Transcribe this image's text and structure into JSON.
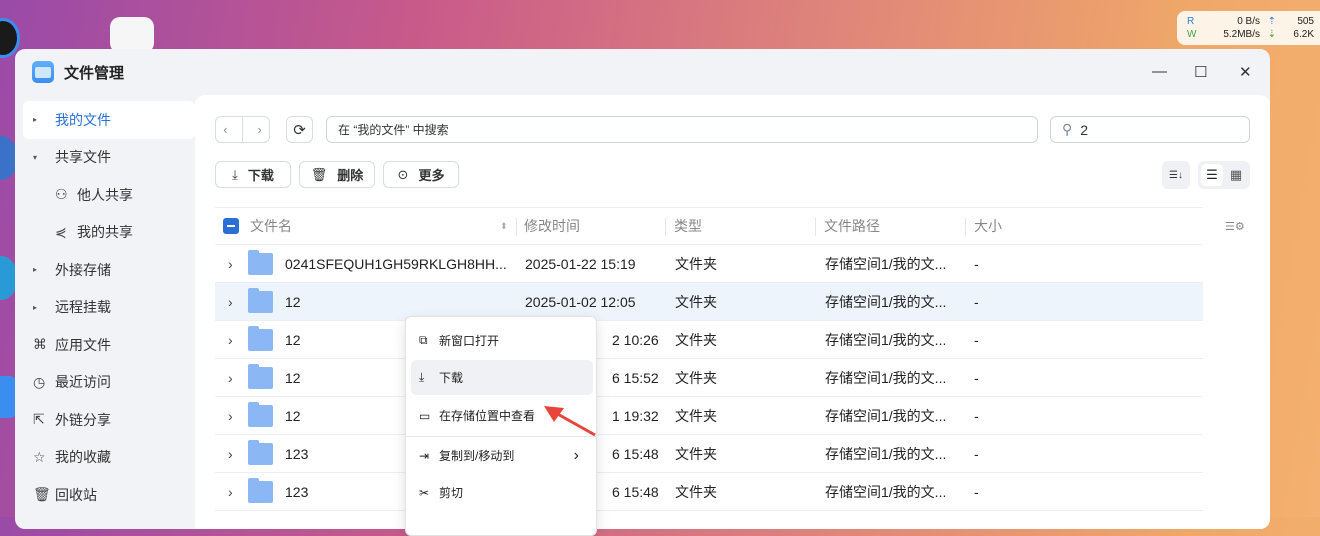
{
  "network": {
    "read_label": "R",
    "write_label": "W",
    "read_speed": "0  B/s",
    "write_speed": "5.2MB/s",
    "up_value": "505",
    "down_value": "6.2K"
  },
  "window": {
    "title": "文件管理",
    "minimize": "—",
    "maximize": "☐",
    "close": "✕"
  },
  "sidebar": {
    "items": [
      {
        "label": "我的文件",
        "icon": "triangle-right-icon",
        "glyph": "▸",
        "active": true
      },
      {
        "label": "共享文件",
        "icon": "triangle-down-icon",
        "glyph": "▾"
      },
      {
        "label": "他人共享",
        "icon": "users-icon",
        "glyph": "⚇",
        "sub": true
      },
      {
        "label": "我的共享",
        "icon": "share-icon",
        "glyph": "⋞",
        "sub": true
      },
      {
        "label": "外接存储",
        "icon": "triangle-right-icon",
        "glyph": "▸"
      },
      {
        "label": "远程挂载",
        "icon": "triangle-right-icon",
        "glyph": "▸"
      },
      {
        "label": "应用文件",
        "icon": "apps-icon",
        "glyph": "⌘"
      },
      {
        "label": "最近访问",
        "icon": "clock-icon",
        "glyph": "◷"
      },
      {
        "label": "外链分享",
        "icon": "external-share-icon",
        "glyph": "⇱"
      },
      {
        "label": "我的收藏",
        "icon": "star-icon",
        "glyph": "☆"
      },
      {
        "label": "回收站",
        "icon": "trash-icon",
        "glyph": "🗑"
      }
    ]
  },
  "toolbar": {
    "back": "‹",
    "forward": "›",
    "refresh": "⟳",
    "path_search_placeholder": "在 “我的文件” 中搜索",
    "search_value": "2",
    "search_icon": "⚲",
    "download": "下载",
    "delete": "删除",
    "more": "更多",
    "sort_glyph": "☰↓",
    "list_glyph": "☰",
    "grid_glyph": "▦"
  },
  "table": {
    "headers": [
      "文件名",
      "修改时间",
      "类型",
      "文件路径",
      "大小"
    ],
    "settings_glyph": "☰⚙",
    "rows": [
      {
        "name": "0241SFEQUH1GH59RKLGH8HH...",
        "modified": "2025-01-22 15:19",
        "type": "文件夹",
        "path": "存储空间1/我的文...",
        "size": "-"
      },
      {
        "name": "12",
        "modified": "2025-01-02 12:05",
        "type": "文件夹",
        "path": "存储空间1/我的文...",
        "size": "-",
        "highlighted": true
      },
      {
        "name": "12",
        "modified": "2 10:26",
        "type": "文件夹",
        "path": "存储空间1/我的文...",
        "size": "-"
      },
      {
        "name": "12",
        "modified": "6 15:52",
        "type": "文件夹",
        "path": "存储空间1/我的文...",
        "size": "-"
      },
      {
        "name": "12",
        "modified": "1 19:32",
        "type": "文件夹",
        "path": "存储空间1/我的文...",
        "size": "-"
      },
      {
        "name": "123",
        "modified": "6 15:48",
        "type": "文件夹",
        "path": "存储空间1/我的文...",
        "size": "-"
      },
      {
        "name": "123",
        "modified": "6 15:48",
        "type": "文件夹",
        "path": "存储空间1/我的文...",
        "size": "-"
      }
    ]
  },
  "context_menu": {
    "items": [
      {
        "label": "新窗口打开",
        "glyph": "⧉"
      },
      {
        "label": "下载",
        "glyph": "⤓"
      },
      {
        "label": "在存储位置中查看",
        "glyph": "▭"
      },
      {
        "label": "复制到/移动到",
        "glyph": "⇥",
        "submenu": "›"
      },
      {
        "label": "剪切",
        "glyph": "✂"
      }
    ]
  },
  "colors": {
    "accent": "#2a6fd6",
    "arrow": "#e8443a"
  }
}
